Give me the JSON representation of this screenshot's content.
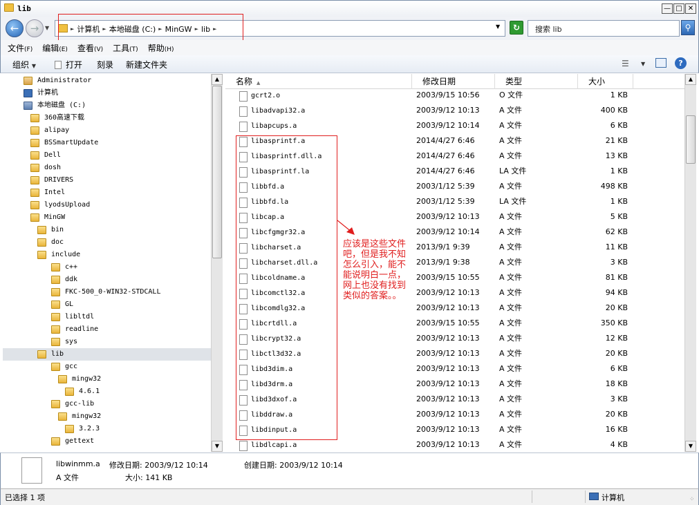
{
  "window": {
    "title": "lib"
  },
  "address": {
    "crumbs": [
      "计算机",
      "本地磁盘 (C:)",
      "MinGW",
      "lib"
    ],
    "search_placeholder": "搜索 lib"
  },
  "menu": [
    {
      "label": "文件",
      "key": "(F)"
    },
    {
      "label": "编辑",
      "key": "(E)"
    },
    {
      "label": "查看",
      "key": "(V)"
    },
    {
      "label": "工具",
      "key": "(T)"
    },
    {
      "label": "帮助",
      "key": "(H)"
    }
  ],
  "toolbar": {
    "organize": "组织",
    "open": "打开",
    "burn": "刻录",
    "new_folder": "新建文件夹"
  },
  "tree": [
    {
      "label": "Administrator",
      "indent": 0,
      "icon": "user"
    },
    {
      "label": "计算机",
      "indent": 0,
      "icon": "computer"
    },
    {
      "label": "本地磁盘 (C:)",
      "indent": 1,
      "icon": "drive"
    },
    {
      "label": "360高速下载",
      "indent": 2,
      "icon": "folder"
    },
    {
      "label": "alipay",
      "indent": 2,
      "icon": "folder"
    },
    {
      "label": "BSSmartUpdate",
      "indent": 2,
      "icon": "folder"
    },
    {
      "label": "Dell",
      "indent": 2,
      "icon": "folder"
    },
    {
      "label": "dosh",
      "indent": 2,
      "icon": "folder"
    },
    {
      "label": "DRIVERS",
      "indent": 2,
      "icon": "folder"
    },
    {
      "label": "Intel",
      "indent": 2,
      "icon": "folder"
    },
    {
      "label": "lyodsUpload",
      "indent": 2,
      "icon": "folder"
    },
    {
      "label": "MinGW",
      "indent": 2,
      "icon": "folder"
    },
    {
      "label": "bin",
      "indent": 3,
      "icon": "folder"
    },
    {
      "label": "doc",
      "indent": 3,
      "icon": "folder"
    },
    {
      "label": "include",
      "indent": 3,
      "icon": "folder"
    },
    {
      "label": "c++",
      "indent": 4,
      "icon": "folder"
    },
    {
      "label": "ddk",
      "indent": 4,
      "icon": "folder"
    },
    {
      "label": "FKC-500_0-WIN32-STDCALL",
      "indent": 4,
      "icon": "folder"
    },
    {
      "label": "GL",
      "indent": 4,
      "icon": "folder"
    },
    {
      "label": "libltdl",
      "indent": 4,
      "icon": "folder"
    },
    {
      "label": "readline",
      "indent": 4,
      "icon": "folder"
    },
    {
      "label": "sys",
      "indent": 4,
      "icon": "folder"
    },
    {
      "label": "lib",
      "indent": 3,
      "icon": "folder",
      "selected": true
    },
    {
      "label": "gcc",
      "indent": 4,
      "icon": "folder"
    },
    {
      "label": "mingw32",
      "indent": 5,
      "icon": "folder"
    },
    {
      "label": "4.6.1",
      "indent": 6,
      "icon": "folder"
    },
    {
      "label": "gcc-lib",
      "indent": 4,
      "icon": "folder"
    },
    {
      "label": "mingw32",
      "indent": 5,
      "icon": "folder"
    },
    {
      "label": "3.2.3",
      "indent": 6,
      "icon": "folder"
    },
    {
      "label": "gettext",
      "indent": 4,
      "icon": "folder"
    }
  ],
  "columns": {
    "name": "名称",
    "date": "修改日期",
    "type": "类型",
    "size": "大小"
  },
  "files": [
    {
      "name": "gcrt2.o",
      "date": "2003/9/15 10:56",
      "type": "O 文件",
      "size": "1 KB"
    },
    {
      "name": "libadvapi32.a",
      "date": "2003/9/12 10:13",
      "type": "A 文件",
      "size": "400 KB"
    },
    {
      "name": "libapcups.a",
      "date": "2003/9/12 10:14",
      "type": "A 文件",
      "size": "6 KB"
    },
    {
      "name": "libasprintf.a",
      "date": "2014/4/27 6:46",
      "type": "A 文件",
      "size": "21 KB"
    },
    {
      "name": "libasprintf.dll.a",
      "date": "2014/4/27 6:46",
      "type": "A 文件",
      "size": "13 KB"
    },
    {
      "name": "libasprintf.la",
      "date": "2014/4/27 6:46",
      "type": "LA 文件",
      "size": "1 KB"
    },
    {
      "name": "libbfd.a",
      "date": "2003/1/12 5:39",
      "type": "A 文件",
      "size": "498 KB"
    },
    {
      "name": "libbfd.la",
      "date": "2003/1/12 5:39",
      "type": "LA 文件",
      "size": "1 KB"
    },
    {
      "name": "libcap.a",
      "date": "2003/9/12 10:13",
      "type": "A 文件",
      "size": "5 KB"
    },
    {
      "name": "libcfgmgr32.a",
      "date": "2003/9/12 10:14",
      "type": "A 文件",
      "size": "62 KB"
    },
    {
      "name": "libcharset.a",
      "date": "2013/9/1 9:39",
      "type": "A 文件",
      "size": "11 KB"
    },
    {
      "name": "libcharset.dll.a",
      "date": "2013/9/1 9:38",
      "type": "A 文件",
      "size": "3 KB"
    },
    {
      "name": "libcoldname.a",
      "date": "2003/9/15 10:55",
      "type": "A 文件",
      "size": "81 KB"
    },
    {
      "name": "libcomctl32.a",
      "date": "2003/9/12 10:13",
      "type": "A 文件",
      "size": "94 KB"
    },
    {
      "name": "libcomdlg32.a",
      "date": "2003/9/12 10:13",
      "type": "A 文件",
      "size": "20 KB"
    },
    {
      "name": "libcrtdll.a",
      "date": "2003/9/15 10:55",
      "type": "A 文件",
      "size": "350 KB"
    },
    {
      "name": "libcrypt32.a",
      "date": "2003/9/12 10:13",
      "type": "A 文件",
      "size": "12 KB"
    },
    {
      "name": "libctl3d32.a",
      "date": "2003/9/12 10:13",
      "type": "A 文件",
      "size": "20 KB"
    },
    {
      "name": "libd3dim.a",
      "date": "2003/9/12 10:13",
      "type": "A 文件",
      "size": "6 KB"
    },
    {
      "name": "libd3drm.a",
      "date": "2003/9/12 10:13",
      "type": "A 文件",
      "size": "18 KB"
    },
    {
      "name": "libd3dxof.a",
      "date": "2003/9/12 10:13",
      "type": "A 文件",
      "size": "3 KB"
    },
    {
      "name": "libddraw.a",
      "date": "2003/9/12 10:13",
      "type": "A 文件",
      "size": "20 KB"
    },
    {
      "name": "libdinput.a",
      "date": "2003/9/12 10:13",
      "type": "A 文件",
      "size": "16 KB"
    },
    {
      "name": "libdlcapi.a",
      "date": "2003/9/12 10:13",
      "type": "A 文件",
      "size": "4 KB"
    }
  ],
  "annotation": {
    "text": "应该是这些文件\n吧，但是我不知\n怎么引入，能不\n能说明白一点，\n网上也没有找到\n类似的答案。。"
  },
  "details": {
    "filename": "libwinmm.a",
    "modified_label": "修改日期: 2003/9/12 10:14",
    "created_label": "创建日期: 2003/9/12 10:14",
    "type": "A 文件",
    "size_label": "大小: 141 KB"
  },
  "status": {
    "selection": "已选择 1 项",
    "location": "计算机"
  },
  "colors": {
    "annotation_red": "#e01d1d",
    "selected_row": "#dfe3e8"
  }
}
